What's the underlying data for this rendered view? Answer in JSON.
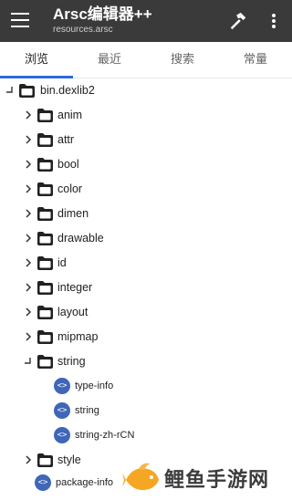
{
  "appbar": {
    "title": "Arsc编辑器++",
    "subtitle": "resources.arsc"
  },
  "tabs": [
    {
      "label": "浏览",
      "active": true
    },
    {
      "label": "最近",
      "active": false
    },
    {
      "label": "搜索",
      "active": false
    },
    {
      "label": "常量",
      "active": false
    }
  ],
  "tree": {
    "root": "bin.dexlib2",
    "folders": [
      "anim",
      "attr",
      "bool",
      "color",
      "dimen",
      "drawable",
      "id",
      "integer",
      "layout",
      "mipmap"
    ],
    "string_folder": "string",
    "string_children": [
      "type-info",
      "string",
      "string-zh-rCN"
    ],
    "style_folder": "style",
    "package_info": "package-info"
  },
  "watermark": {
    "text": "鲤鱼手游网"
  },
  "colors": {
    "appbar": "#3a3a3a",
    "accent": "#2f6ad9",
    "xml_icon": "#3f66b8",
    "watermark_fish": "#f5a623"
  }
}
